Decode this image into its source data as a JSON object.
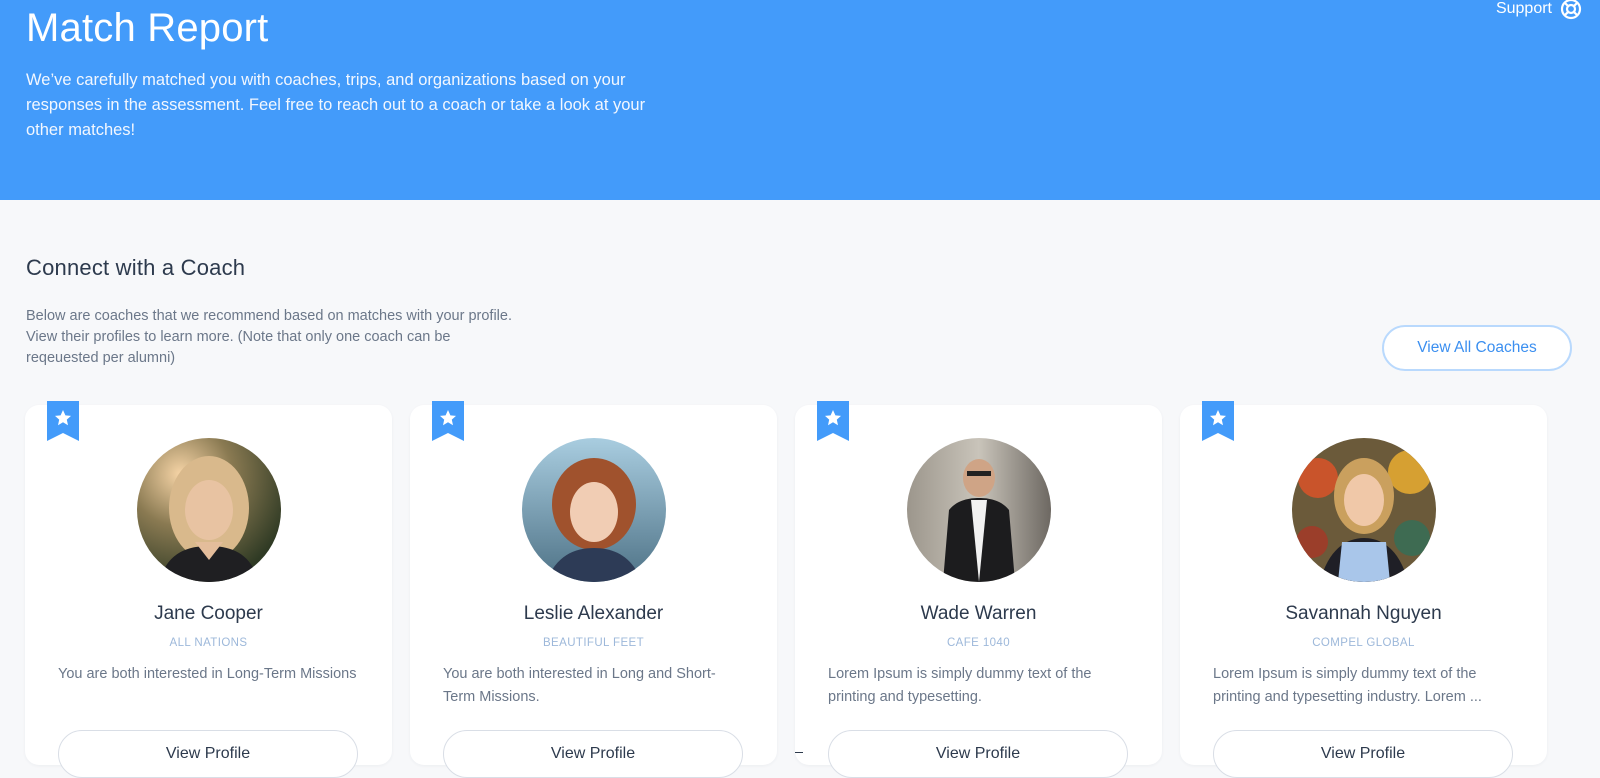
{
  "header": {
    "title": "Match Report",
    "description": "We’ve carefully matched you with coaches, trips, and organizations based on your responses in the assessment. Feel free to reach out to a coach or take a look at your other matches!",
    "support_label": "Support",
    "support_icon": "lifebuoy-icon",
    "background_color": "#439bfa"
  },
  "section": {
    "title": "Connect with a Coach",
    "description": "Below are coaches that we recommend based on matches with your profile. View their profiles to learn more. (Note that only one coach can be reqeuested per alumni)",
    "view_all_label": "View All Coaches"
  },
  "coaches": [
    {
      "name": "Jane Cooper",
      "organization": "ALL NATIONS",
      "description": "You are both interested in Long-Term Missions",
      "button_label": "View Profile",
      "badge_icon": "star-bookmark-icon"
    },
    {
      "name": "Leslie Alexander",
      "organization": "BEAUTIFUL FEET",
      "description": "You are both interested in Long and Short-Term Missions.",
      "button_label": "View Profile",
      "badge_icon": "star-bookmark-icon"
    },
    {
      "name": "Wade Warren",
      "organization": "CAFE 1040",
      "description": "Lorem Ipsum is simply dummy text of the printing and typesetting.",
      "button_label": "View Profile",
      "badge_icon": "star-bookmark-icon"
    },
    {
      "name": "Savannah Nguyen",
      "organization": "COMPEL GLOBAL",
      "description": "Lorem Ipsum is simply dummy text of the printing and typesetting industry. Lorem ...",
      "button_label": "View Profile",
      "badge_icon": "star-bookmark-icon"
    }
  ],
  "colors": {
    "accent": "#439bfa",
    "link": "#3b8ff0",
    "heading": "#2d3a4d",
    "muted": "#6b7789",
    "org_label": "#9db8da"
  }
}
